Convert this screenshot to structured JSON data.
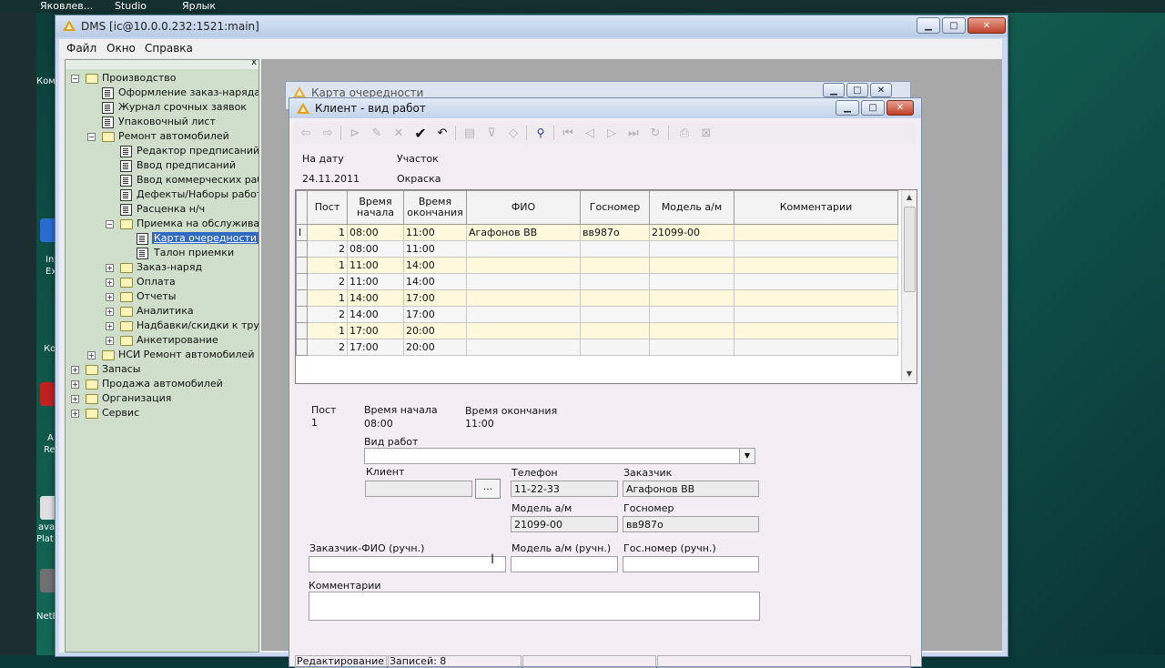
{
  "desktop": {
    "top_labels": [
      "Яковлев...",
      "Studio",
      "Ярлык"
    ],
    "side_labels": [
      "Комп",
      "Int",
      "Ex",
      "Ко",
      "A",
      "Re",
      "ava",
      "Plat",
      "NetB"
    ]
  },
  "main_window": {
    "title": "DMS [ic@10.0.0.232:1521:main]",
    "menu": [
      "Файл",
      "Окно",
      "Справка"
    ]
  },
  "tree": {
    "close_glyph": "x",
    "items": [
      {
        "label": "Производство"
      },
      {
        "label": "Оформление заказ-наряда"
      },
      {
        "label": "Журнал срочных заявок"
      },
      {
        "label": "Упаковочный лист"
      },
      {
        "label": "Ремонт автомобилей"
      },
      {
        "label": "Редактор предписаний"
      },
      {
        "label": "Ввод предписаний"
      },
      {
        "label": "Ввод коммерческих работ"
      },
      {
        "label": "Дефекты/Наборы работ"
      },
      {
        "label": "Расценка н/ч"
      },
      {
        "label": "Приемка на обслуживание"
      },
      {
        "label": "Карта очередности"
      },
      {
        "label": "Талон приемки"
      },
      {
        "label": "Заказ-наряд"
      },
      {
        "label": "Оплата"
      },
      {
        "label": "Отчеты"
      },
      {
        "label": "Аналитика"
      },
      {
        "label": "Надбавки/скидки к трудо"
      },
      {
        "label": "Анкетирование"
      },
      {
        "label": "НСИ Ремонт автомобилей"
      },
      {
        "label": "Запасы"
      },
      {
        "label": "Продажа автомобилей"
      },
      {
        "label": "Организация"
      },
      {
        "label": "Сервис"
      }
    ]
  },
  "back_window": {
    "title": "Карта очередности"
  },
  "front_window": {
    "title": "Клиент - вид работ",
    "header": {
      "date_label": "На дату",
      "date_value": "24.11.2011",
      "section_label": "Участок",
      "section_value": "Окраска"
    },
    "grid": {
      "columns": [
        "Пост",
        "Время начала",
        "Время окончания",
        "ФИО",
        "Госномер",
        "Модель а/м",
        "Комментарии"
      ],
      "rows": [
        {
          "post": "1",
          "start": "08:00",
          "end": "11:00",
          "fio": "Агафонов ВВ",
          "plate": "вв987о",
          "model": "21099-00",
          "comment": ""
        },
        {
          "post": "2",
          "start": "08:00",
          "end": "11:00",
          "fio": "",
          "plate": "",
          "model": "",
          "comment": ""
        },
        {
          "post": "1",
          "start": "11:00",
          "end": "14:00",
          "fio": "",
          "plate": "",
          "model": "",
          "comment": ""
        },
        {
          "post": "2",
          "start": "11:00",
          "end": "14:00",
          "fio": "",
          "plate": "",
          "model": "",
          "comment": ""
        },
        {
          "post": "1",
          "start": "14:00",
          "end": "17:00",
          "fio": "",
          "plate": "",
          "model": "",
          "comment": ""
        },
        {
          "post": "2",
          "start": "14:00",
          "end": "17:00",
          "fio": "",
          "plate": "",
          "model": "",
          "comment": ""
        },
        {
          "post": "1",
          "start": "17:00",
          "end": "20:00",
          "fio": "",
          "plate": "",
          "model": "",
          "comment": ""
        },
        {
          "post": "2",
          "start": "17:00",
          "end": "20:00",
          "fio": "",
          "plate": "",
          "model": "",
          "comment": ""
        }
      ],
      "row_cursor": "I"
    },
    "detail": {
      "post_label": "Пост",
      "post_value": "1",
      "start_label": "Время начала",
      "start_value": "08:00",
      "end_label": "Время окончания",
      "end_value": "11:00",
      "work_type_label": "Вид работ",
      "work_type_value": "",
      "client_label": "Клиент",
      "client_value": "",
      "client_button": "...",
      "phone_label": "Телефон",
      "phone_value": "11-22-33",
      "customer_label": "Заказчик",
      "customer_value": "Агафонов ВВ",
      "model_label": "Модель а/м",
      "model_value": "21099-00",
      "plate_label": "Госномер",
      "plate_value": "вв987о",
      "manual_fio_label": "Заказчик-ФИО (ручн.)",
      "manual_fio_value": "",
      "manual_model_label": "Модель а/м (ручн.)",
      "manual_model_value": "",
      "manual_plate_label": "Гос.номер (ручн.)",
      "manual_plate_value": "",
      "comments_label": "Комментарии",
      "comments_value": ""
    },
    "status": {
      "mode": "Редактирование за",
      "records": "Записей: 8"
    }
  },
  "glyphs": {
    "minimize": "▁",
    "maximize": "□",
    "close": "✕",
    "combo": "▼",
    "scroll_up": "▲",
    "scroll_down": "▼",
    "text_cursor": "I"
  }
}
